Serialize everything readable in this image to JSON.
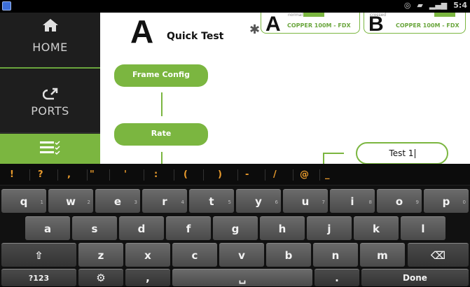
{
  "status": {
    "time": "5:4"
  },
  "sidebar": {
    "items": [
      {
        "label": "HOME",
        "icon": "home-icon"
      },
      {
        "label": "PORTS",
        "icon": "ports-icon"
      },
      {
        "label": "",
        "icon": "tests-list-icon"
      }
    ]
  },
  "header": {
    "letter": "A",
    "title": "Quick Test",
    "port_a": {
      "letter": "A",
      "mode": "COPPER 100M - FDX",
      "tag": "normal"
    },
    "port_b": {
      "letter": "B",
      "mode": "COPPER 100M - FDX",
      "tag": "crossed"
    }
  },
  "flow": {
    "frame_config": "Frame Config",
    "rate": "Rate",
    "test_name_value": "Test 1"
  },
  "keyboard": {
    "symbols": [
      "!",
      "?",
      ",",
      "\"",
      "'",
      ":",
      "(",
      ")",
      "-",
      "/",
      "@",
      "_"
    ],
    "row1": [
      {
        "k": "q",
        "h": "1"
      },
      {
        "k": "w",
        "h": "2"
      },
      {
        "k": "e",
        "h": "3"
      },
      {
        "k": "r",
        "h": "4"
      },
      {
        "k": "t",
        "h": "5"
      },
      {
        "k": "y",
        "h": "6"
      },
      {
        "k": "u",
        "h": "7"
      },
      {
        "k": "i",
        "h": "8"
      },
      {
        "k": "o",
        "h": "9"
      },
      {
        "k": "p",
        "h": "0"
      }
    ],
    "row2": [
      "a",
      "s",
      "d",
      "f",
      "g",
      "h",
      "j",
      "k",
      "l"
    ],
    "row3": [
      "z",
      "x",
      "c",
      "v",
      "b",
      "n",
      "m"
    ],
    "shift": "⇧",
    "backspace": "⌫",
    "num_label": "?123",
    "settings_icon": "settings-icon",
    "comma": ",",
    "period": ".",
    "done": "Done"
  }
}
